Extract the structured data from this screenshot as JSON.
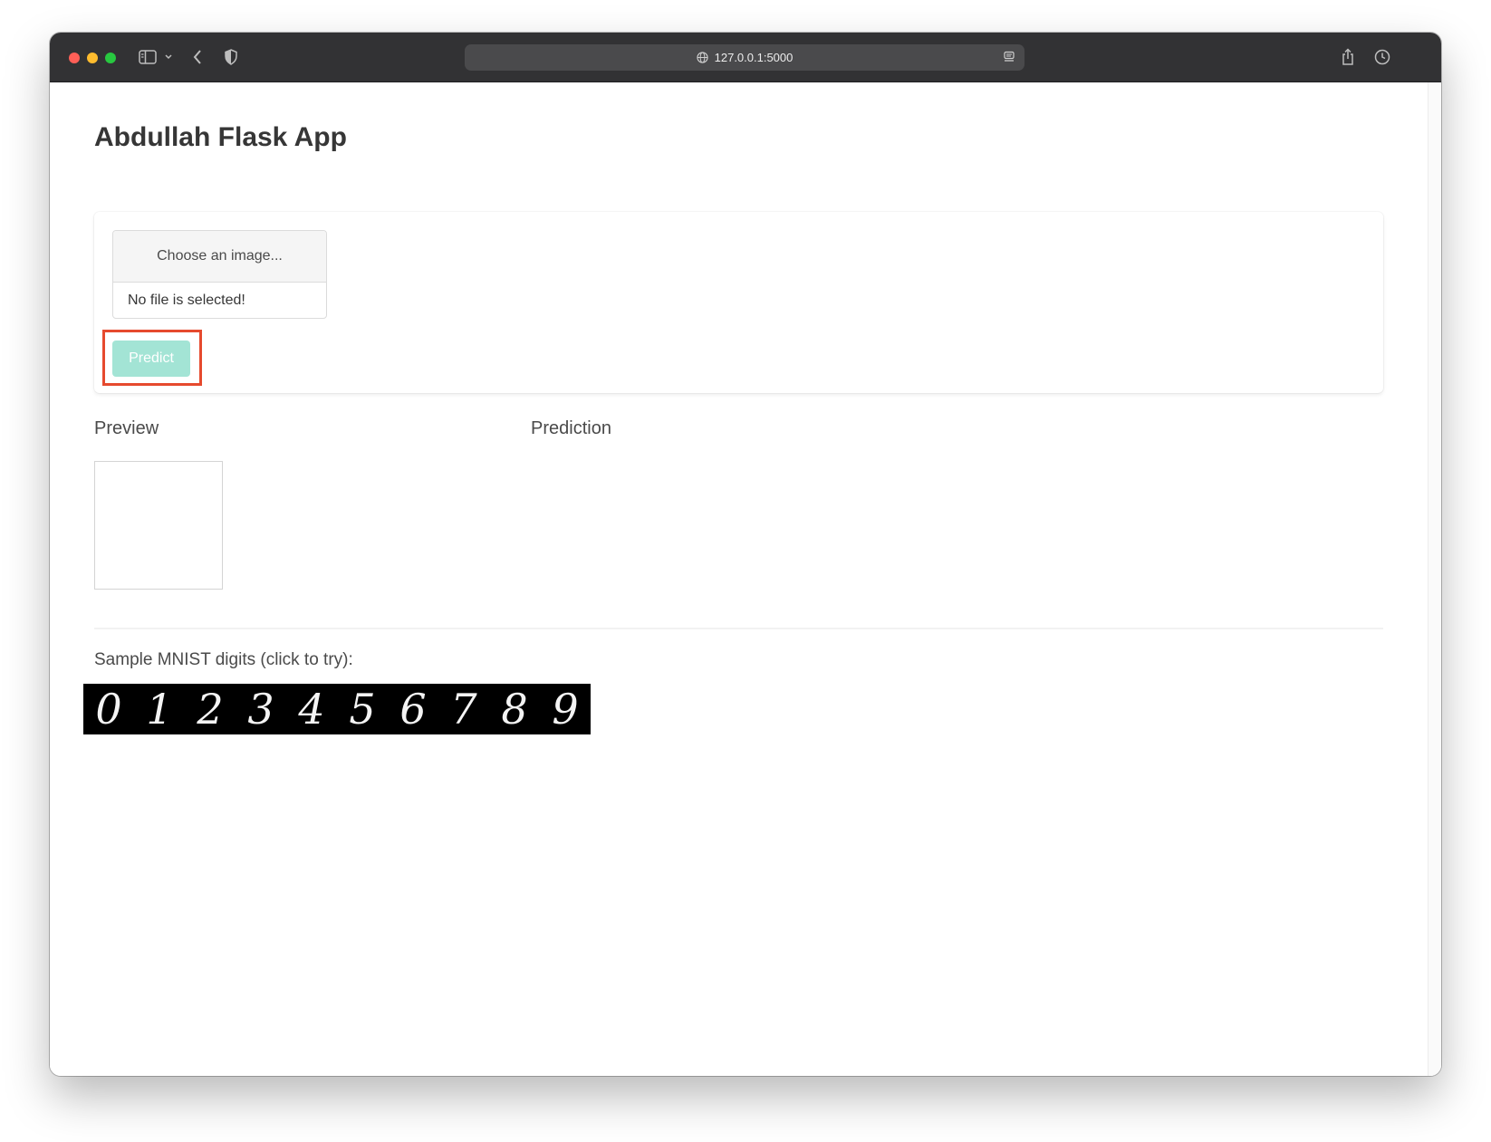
{
  "browser": {
    "url": "127.0.0.1:5000",
    "icons": [
      "sidebar-icon",
      "chevron-down-icon",
      "back-icon",
      "shield-icon",
      "globe-icon",
      "reader-icon",
      "share-icon",
      "history-icon"
    ]
  },
  "page": {
    "title": "Abdullah Flask App",
    "upload": {
      "choose_label": "Choose an image...",
      "file_status": "No file is selected!"
    },
    "predict_label": "Predict",
    "preview_label": "Preview",
    "prediction_label": "Prediction",
    "samples_label": "Sample MNIST digits (click to try):",
    "samples": [
      "0",
      "1",
      "2",
      "3",
      "4",
      "5",
      "6",
      "7",
      "8",
      "9"
    ]
  },
  "colors": {
    "predict_button": "#a3e4d5",
    "highlight": "#e64a2e",
    "titlebar": "#323234"
  }
}
